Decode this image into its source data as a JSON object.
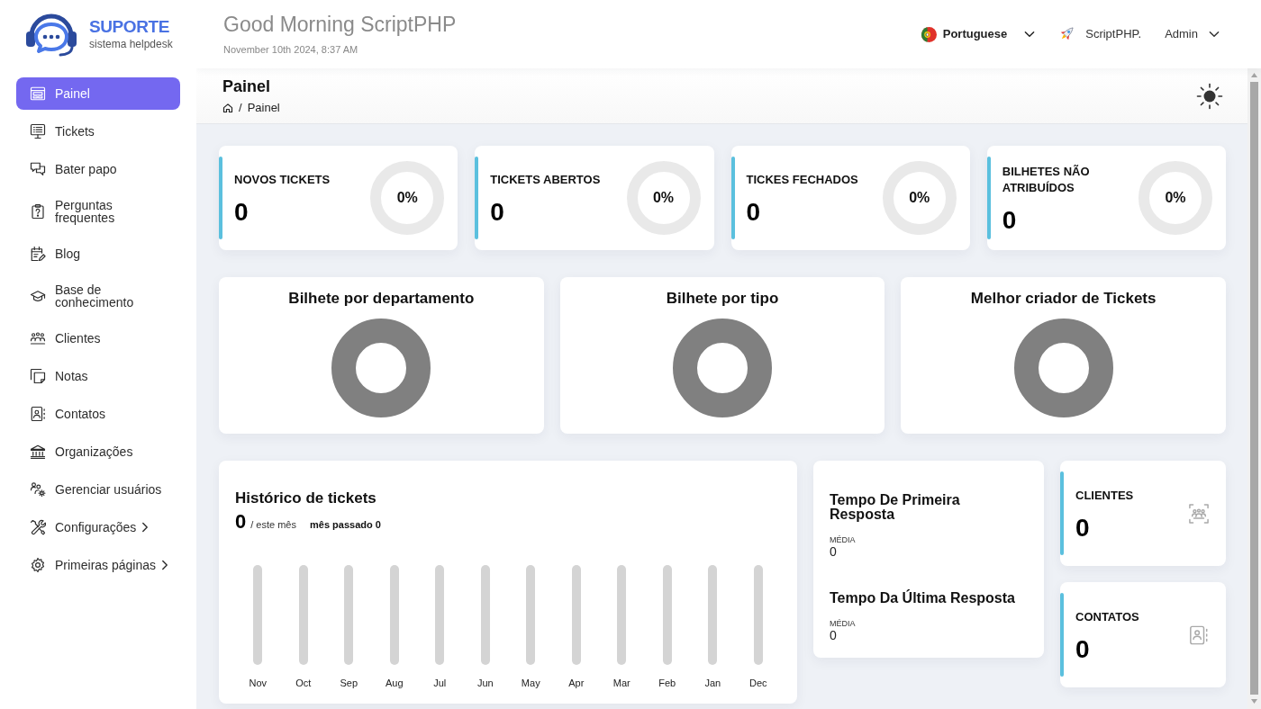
{
  "brand": {
    "name": "SUPORTE",
    "tagline": "sistema helpdesk"
  },
  "header": {
    "greeting": "Good Morning ScriptPHP",
    "date": "November 10th 2024, 8:37 AM",
    "language": "Portuguese",
    "site": "ScriptPHP.",
    "user": "Admin"
  },
  "sidebar": {
    "items": [
      {
        "label": "Painel",
        "selected": true,
        "has_submenu": false
      },
      {
        "label": "Tickets",
        "selected": false,
        "has_submenu": false
      },
      {
        "label": "Bater papo",
        "selected": false,
        "has_submenu": false
      },
      {
        "label": "Perguntas frequentes",
        "selected": false,
        "has_submenu": false
      },
      {
        "label": "Blog",
        "selected": false,
        "has_submenu": false
      },
      {
        "label": "Base de conhecimento",
        "selected": false,
        "has_submenu": false
      },
      {
        "label": "Clientes",
        "selected": false,
        "has_submenu": false
      },
      {
        "label": "Notas",
        "selected": false,
        "has_submenu": false
      },
      {
        "label": "Contatos",
        "selected": false,
        "has_submenu": false
      },
      {
        "label": "Organizações",
        "selected": false,
        "has_submenu": false
      },
      {
        "label": "Gerenciar usuários",
        "selected": false,
        "has_submenu": false
      },
      {
        "label": "Configurações",
        "selected": false,
        "has_submenu": true
      },
      {
        "label": "Primeiras páginas",
        "selected": false,
        "has_submenu": true
      }
    ]
  },
  "page": {
    "title": "Painel",
    "breadcrumb": {
      "separator": "/",
      "current": "Painel"
    }
  },
  "stats": [
    {
      "title": "NOVOS TICKETS",
      "value": "0",
      "percent": "0%",
      "level": 0
    },
    {
      "title": "TICKETS ABERTOS",
      "value": "0",
      "percent": "0%",
      "level": 0
    },
    {
      "title": "TICKES FECHADOS",
      "value": "0",
      "percent": "0%",
      "level": 0
    },
    {
      "title": "BILHETES NÃO ATRIBUÍDOS",
      "value": "0",
      "percent": "0%",
      "level": 0
    }
  ],
  "charts": [
    {
      "title": "Bilhete por departamento"
    },
    {
      "title": "Bilhete por tipo"
    },
    {
      "title": "Melhor criador de Tickets"
    }
  ],
  "history": {
    "title": "Histórico de tickets",
    "count": "0",
    "period": "/ este mês",
    "previous": "mês passado 0",
    "months": [
      "Nov",
      "Oct",
      "Sep",
      "Aug",
      "Jul",
      "Jun",
      "May",
      "Apr",
      "Mar",
      "Feb",
      "Jan",
      "Dec"
    ]
  },
  "response_times": [
    {
      "title": "Tempo De Primeira Resposta",
      "label": "MÉDIA",
      "value": "0"
    },
    {
      "title": "Tempo Da Última Resposta",
      "label": "MÉDIA",
      "value": "0"
    }
  ],
  "totals": [
    {
      "title": "CLIENTES",
      "value": "0"
    },
    {
      "title": "CONTATOS",
      "value": "0"
    }
  ]
}
